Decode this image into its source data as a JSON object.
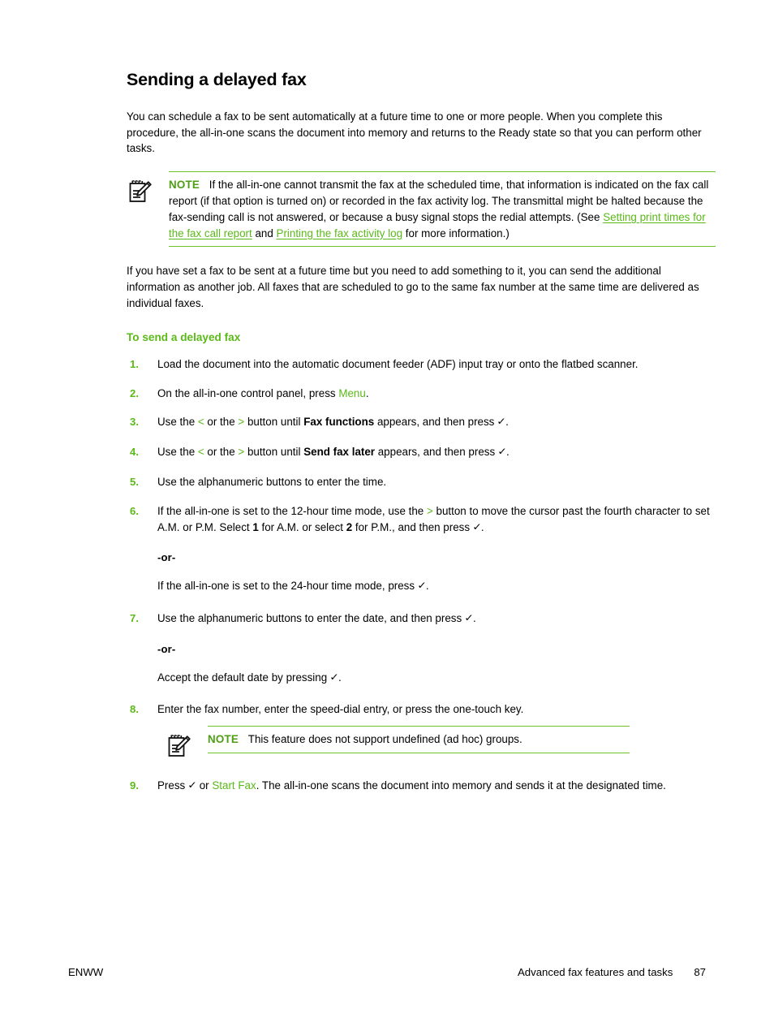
{
  "document": {
    "title": "Sending a delayed fax",
    "intro": "You can schedule a fax to be sent automatically at a future time to one or more people. When you complete this procedure, the all-in-one scans the document into memory and returns to the Ready state so that you can perform other tasks.",
    "second_paragraph": "If you have set a fax to be sent at a future time but you need to add something to it, you can send the additional information as another job. All faxes that are scheduled to go to the same fax number at the same time are delivered as individual faxes.",
    "subheading": "To send a delayed fax"
  },
  "note_primary": {
    "icon": "note-pad-pencil-icon",
    "label": "NOTE",
    "text_part_1": "If the all-in-one cannot transmit the fax at the scheduled time, that information is indicated on the fax call report (if that option is turned on) or recorded in the fax activity log. The transmittal might be halted because the fax-sending call is not answered, or because a busy signal stops the redial attempts. (See ",
    "link_1": "Setting print times for the fax call report",
    "text_part_2": " and ",
    "link_2": "Printing the fax activity log",
    "text_part_3": " for more information.)"
  },
  "note_secondary": {
    "icon": "note-pad-pencil-icon",
    "label": "NOTE",
    "text": "This feature does not support undefined (ad hoc) groups."
  },
  "steps": [
    {
      "number": "1.",
      "text": "Load the document into the automatic document feeder (ADF) input tray or onto the flatbed scanner."
    },
    {
      "number": "2.",
      "pre": "On the all-in-one control panel, press ",
      "green": "Menu",
      "post": "."
    },
    {
      "number": "3.",
      "a": "Use the ",
      "g1": "<",
      "b": " or the ",
      "g2": ">",
      "c": " button until ",
      "bold": "Fax functions",
      "d": " appears, and then press ",
      "check": "✓",
      "e": "."
    },
    {
      "number": "4.",
      "a": "Use the ",
      "g1": "<",
      "b": " or the ",
      "g2": ">",
      "c": " button until ",
      "bold": "Send fax later",
      "d": " appears, and then press ",
      "check": "✓",
      "e": "."
    },
    {
      "number": "5.",
      "text": "Use the alphanumeric buttons to enter the time."
    },
    {
      "number": "6.",
      "a": "If the all-in-one is set to the 12-hour time mode, use the ",
      "g1": ">",
      "b": " button to move the cursor past the fourth character to set A.M. or P.M. Select ",
      "bold1": "1",
      "c": " for A.M. or select ",
      "bold2": "2",
      "d": " for P.M., and then press ",
      "check": "✓",
      "e": ".",
      "or_label": "-or-",
      "alt_a": "If the all-in-one is set to the 24-hour time mode, press ",
      "alt_check": "✓",
      "alt_b": "."
    },
    {
      "number": "7.",
      "a": "Use the alphanumeric buttons to enter the date, and then press ",
      "check": "✓",
      "b": ".",
      "or_label": "-or-",
      "alt_a": "Accept the default date by pressing ",
      "alt_check": "✓",
      "alt_b": "."
    },
    {
      "number": "8.",
      "text": "Enter the fax number, enter the speed-dial entry, or press the one-touch key."
    },
    {
      "number": "9.",
      "a": "Press ",
      "check": "✓",
      "b": " or ",
      "green": "Start Fax",
      "c": ". The all-in-one scans the document into memory and sends it at the designated time."
    }
  ],
  "footer": {
    "left": "ENWW",
    "chapter": "Advanced fax features and tasks",
    "page_number": "87"
  },
  "colors": {
    "accent_green": "#5bb918",
    "note_label_green": "#4e9e13",
    "rule_green": "#6fbf2a",
    "text_black": "#000000"
  }
}
